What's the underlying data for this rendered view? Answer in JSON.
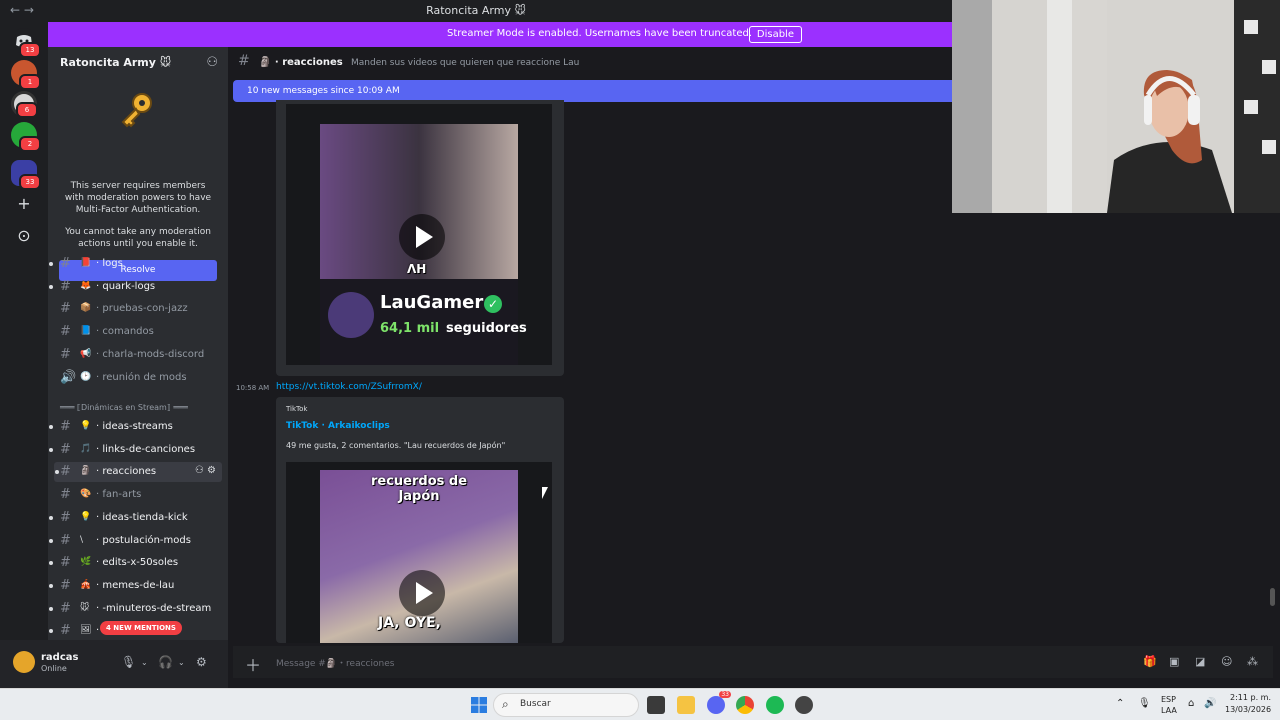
{
  "window": {
    "title": "Ratoncita Army 🐭"
  },
  "streamer_banner": {
    "text": "Streamer Mode is enabled. Usernames have been truncated.",
    "button": "Disable"
  },
  "rail": {
    "servers": [
      {
        "badge": "13",
        "color": "#5865f2"
      },
      {
        "badge": "1",
        "color": "#c9562f"
      },
      {
        "badge": "6",
        "color": "#d8d8d8"
      },
      {
        "badge": "2",
        "color": "#26a83a"
      },
      {
        "badge": "33",
        "color": "#3b3fa5"
      }
    ],
    "add_icon": "+",
    "explore_icon": "⊙"
  },
  "server": {
    "name": "Ratoncita Army 🐭",
    "mfa_text_1": "This server requires members with moderation powers to have Multi-Factor Authentication.",
    "mfa_text_2": "You cannot take any moderation actions until you enable it.",
    "resolve": "Resolve"
  },
  "channels": [
    {
      "name": "logs",
      "emoji": "📕",
      "unread": true,
      "dot": true
    },
    {
      "name": "quark-logs",
      "emoji": "🦊",
      "unread": true,
      "dot": true
    },
    {
      "name": "pruebas-con-jazz",
      "emoji": "📦",
      "unread": false,
      "dot": false
    },
    {
      "name": "comandos",
      "emoji": "📘",
      "unread": false,
      "dot": false
    },
    {
      "name": "charla-mods-discord",
      "emoji": "📢",
      "unread": false,
      "dot": false
    },
    {
      "name": "reunión de mods",
      "emoji": "🕑",
      "unread": false,
      "dot": false
    }
  ],
  "category2": "═══ ⟦Dinámicas en Stream⟧ ═══",
  "channels2": [
    {
      "name": "ideas-streams",
      "emoji": "💡",
      "unread": true,
      "dot": true
    },
    {
      "name": "links-de-canciones",
      "emoji": "🎵",
      "unread": true,
      "dot": true
    },
    {
      "name": "reacciones",
      "emoji": "🗿",
      "unread": true,
      "dot": true
    },
    {
      "name": "fan-arts",
      "emoji": "🎨",
      "unread": false,
      "dot": false
    },
    {
      "name": "ideas-tienda-kick",
      "emoji": "💡",
      "unread": true,
      "dot": true
    },
    {
      "name": "postulación-mods",
      "emoji": "\\",
      "unread": true,
      "dot": true
    },
    {
      "name": "edits-x-50soles",
      "emoji": "🌿",
      "unread": true,
      "dot": true
    },
    {
      "name": "memes-de-lau",
      "emoji": "🎪",
      "unread": true,
      "dot": true
    },
    {
      "name": "-minuteros-de-stream",
      "emoji": "🐭",
      "unread": true,
      "dot": true
    },
    {
      "name": "-",
      "emoji": "🖼",
      "unread": true,
      "dot": true
    }
  ],
  "mentions_pill": "4 NEW MENTIONS",
  "user": {
    "name": "radcas",
    "status": "Online"
  },
  "chat": {
    "channel": "reacciones",
    "emoji": "🗿",
    "topic": "Manden sus videos que quieren que reaccione Lau",
    "new_messages": "10 new messages since 10:09 AM",
    "card_watermark": "ΛH",
    "card_name": "LauGamer",
    "card_followers": "64,1 mil",
    "card_followers_label": "seguidores",
    "msg_time": "10:58 AM",
    "msg_link": "https://vt.tiktok.com/ZSufrromX/",
    "embed_provider": "TikTok",
    "embed_author": "TikTok · Arkaikoclips",
    "embed_desc": "49 me gusta, 2 comentarios. \"Lau recuerdos de Japón\"",
    "video2_title": "recuerdos de Japón",
    "video2_caption": "JA, OYE,",
    "composer_placeholder": "Message #🗿・reacciones"
  },
  "taskbar": {
    "search": "Buscar",
    "lang_1": "ESP",
    "lang_2": "LAA",
    "time": "2:11 p. m.",
    "date": "13/03/2026",
    "discord_badge": "33"
  },
  "colors": {
    "accent": "#5865f2",
    "streamer": "#9b30ff",
    "mention": "#f23f43",
    "link": "#00a8fc"
  }
}
